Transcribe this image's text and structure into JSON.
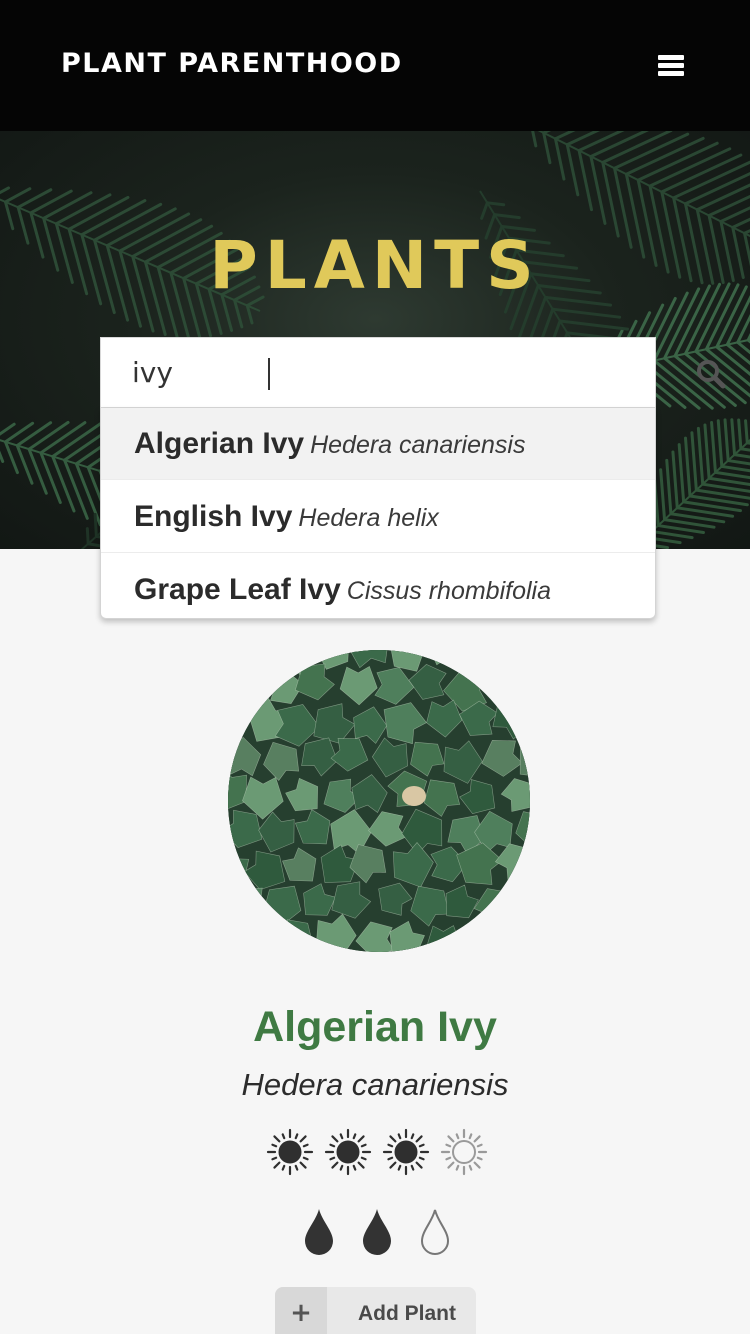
{
  "header": {
    "brand": "PLANT PARENTHOOD",
    "menu_icon": "hamburger-menu-icon"
  },
  "hero": {
    "title": "PLANTS",
    "title_color": "#e0c95a"
  },
  "search": {
    "value": "ivy",
    "icon": "search-icon"
  },
  "suggestions": [
    {
      "common": "Algerian Ivy",
      "scientific": "Hedera canariensis",
      "highlighted": true
    },
    {
      "common": "English Ivy",
      "scientific": "Hedera helix",
      "highlighted": false
    },
    {
      "common": "Grape Leaf Ivy",
      "scientific": "Cissus rhombifolia",
      "highlighted": false
    }
  ],
  "plant": {
    "name": "Algerian Ivy",
    "scientific": "Hedera canariensis",
    "name_color": "#3f7a43",
    "sun_rating": 3,
    "sun_max": 4,
    "water_rating": 2,
    "water_max": 3
  },
  "add_button": {
    "icon": "plus-icon",
    "label": "Add Plant"
  }
}
